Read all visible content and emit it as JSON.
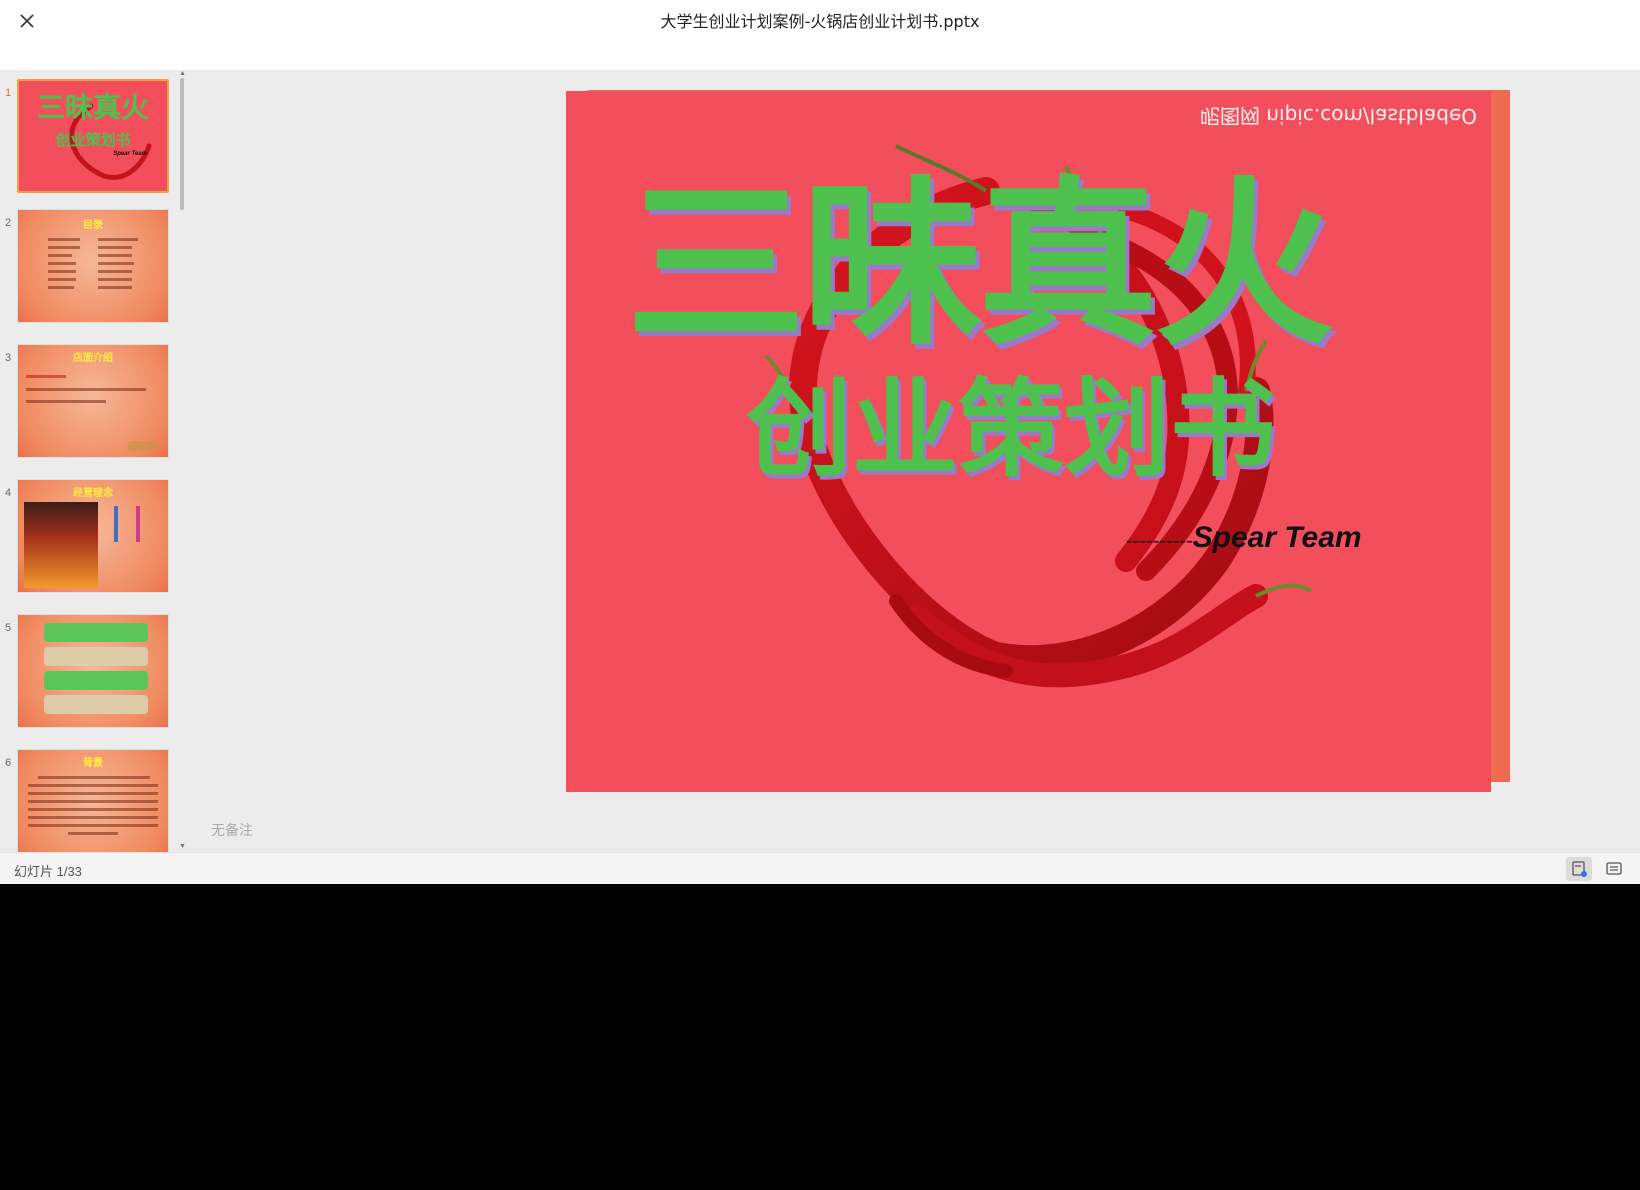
{
  "window": {
    "title": "大学生创业计划案例-火锅店创业计划书.pptx"
  },
  "thumbnails": [
    {
      "num": "1",
      "title": "三昧真火",
      "subtitle": "创业策划书",
      "team": "Spear Team"
    },
    {
      "num": "2",
      "title": "目录"
    },
    {
      "num": "3",
      "title": "店面介绍"
    },
    {
      "num": "4",
      "title": "经营理念"
    },
    {
      "num": "5"
    },
    {
      "num": "6",
      "title": "背景"
    }
  ],
  "slide": {
    "watermark": "呢图网 nipic.com/lastbladeO",
    "title": "三昧真火",
    "subtitle": "创业策划书",
    "dashes": "----------",
    "team": "Spear Team"
  },
  "notes": {
    "placeholder": "无备注"
  },
  "status": {
    "slide_counter": "幻灯片 1/33"
  },
  "colors": {
    "slide_bg": "#f34e5b",
    "title_text": "#4ec04e",
    "accent": "#f0a04a"
  }
}
